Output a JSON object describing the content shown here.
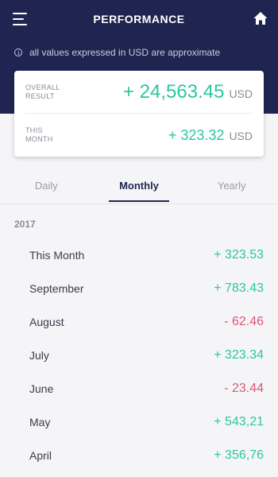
{
  "header": {
    "title": "PERFORMANCE",
    "notice": "all values expressed in USD are approximate"
  },
  "summary": {
    "overall": {
      "label_line1": "OVERALL",
      "label_line2": "RESULT",
      "amount": "+ 24,563.45",
      "currency": "USD"
    },
    "this_month": {
      "label_line1": "THIS",
      "label_line2": "MONTH",
      "amount": "+ 323.32",
      "currency": "USD"
    }
  },
  "tabs": [
    {
      "label": "Daily"
    },
    {
      "label": "Monthly",
      "active": true
    },
    {
      "label": "Yearly"
    }
  ],
  "year": "2017",
  "rows": [
    {
      "label": "This Month",
      "value": "+ 323.53",
      "sign": "pos"
    },
    {
      "label": "September",
      "value": "+ 783.43",
      "sign": "pos"
    },
    {
      "label": "August",
      "value": "- 62.46",
      "sign": "neg"
    },
    {
      "label": "July",
      "value": "+ 323.34",
      "sign": "pos"
    },
    {
      "label": "June",
      "value": "- 23.44",
      "sign": "neg"
    },
    {
      "label": "May",
      "value": "+ 543,21",
      "sign": "pos"
    },
    {
      "label": "April",
      "value": "+ 356,76",
      "sign": "pos"
    }
  ],
  "colors": {
    "header_bg": "#1f2550",
    "positive": "#2bc79f",
    "negative": "#d65a78"
  },
  "icons": {
    "menu": "hamburger-menu-icon",
    "home": "home-icon",
    "info": "info-icon"
  }
}
